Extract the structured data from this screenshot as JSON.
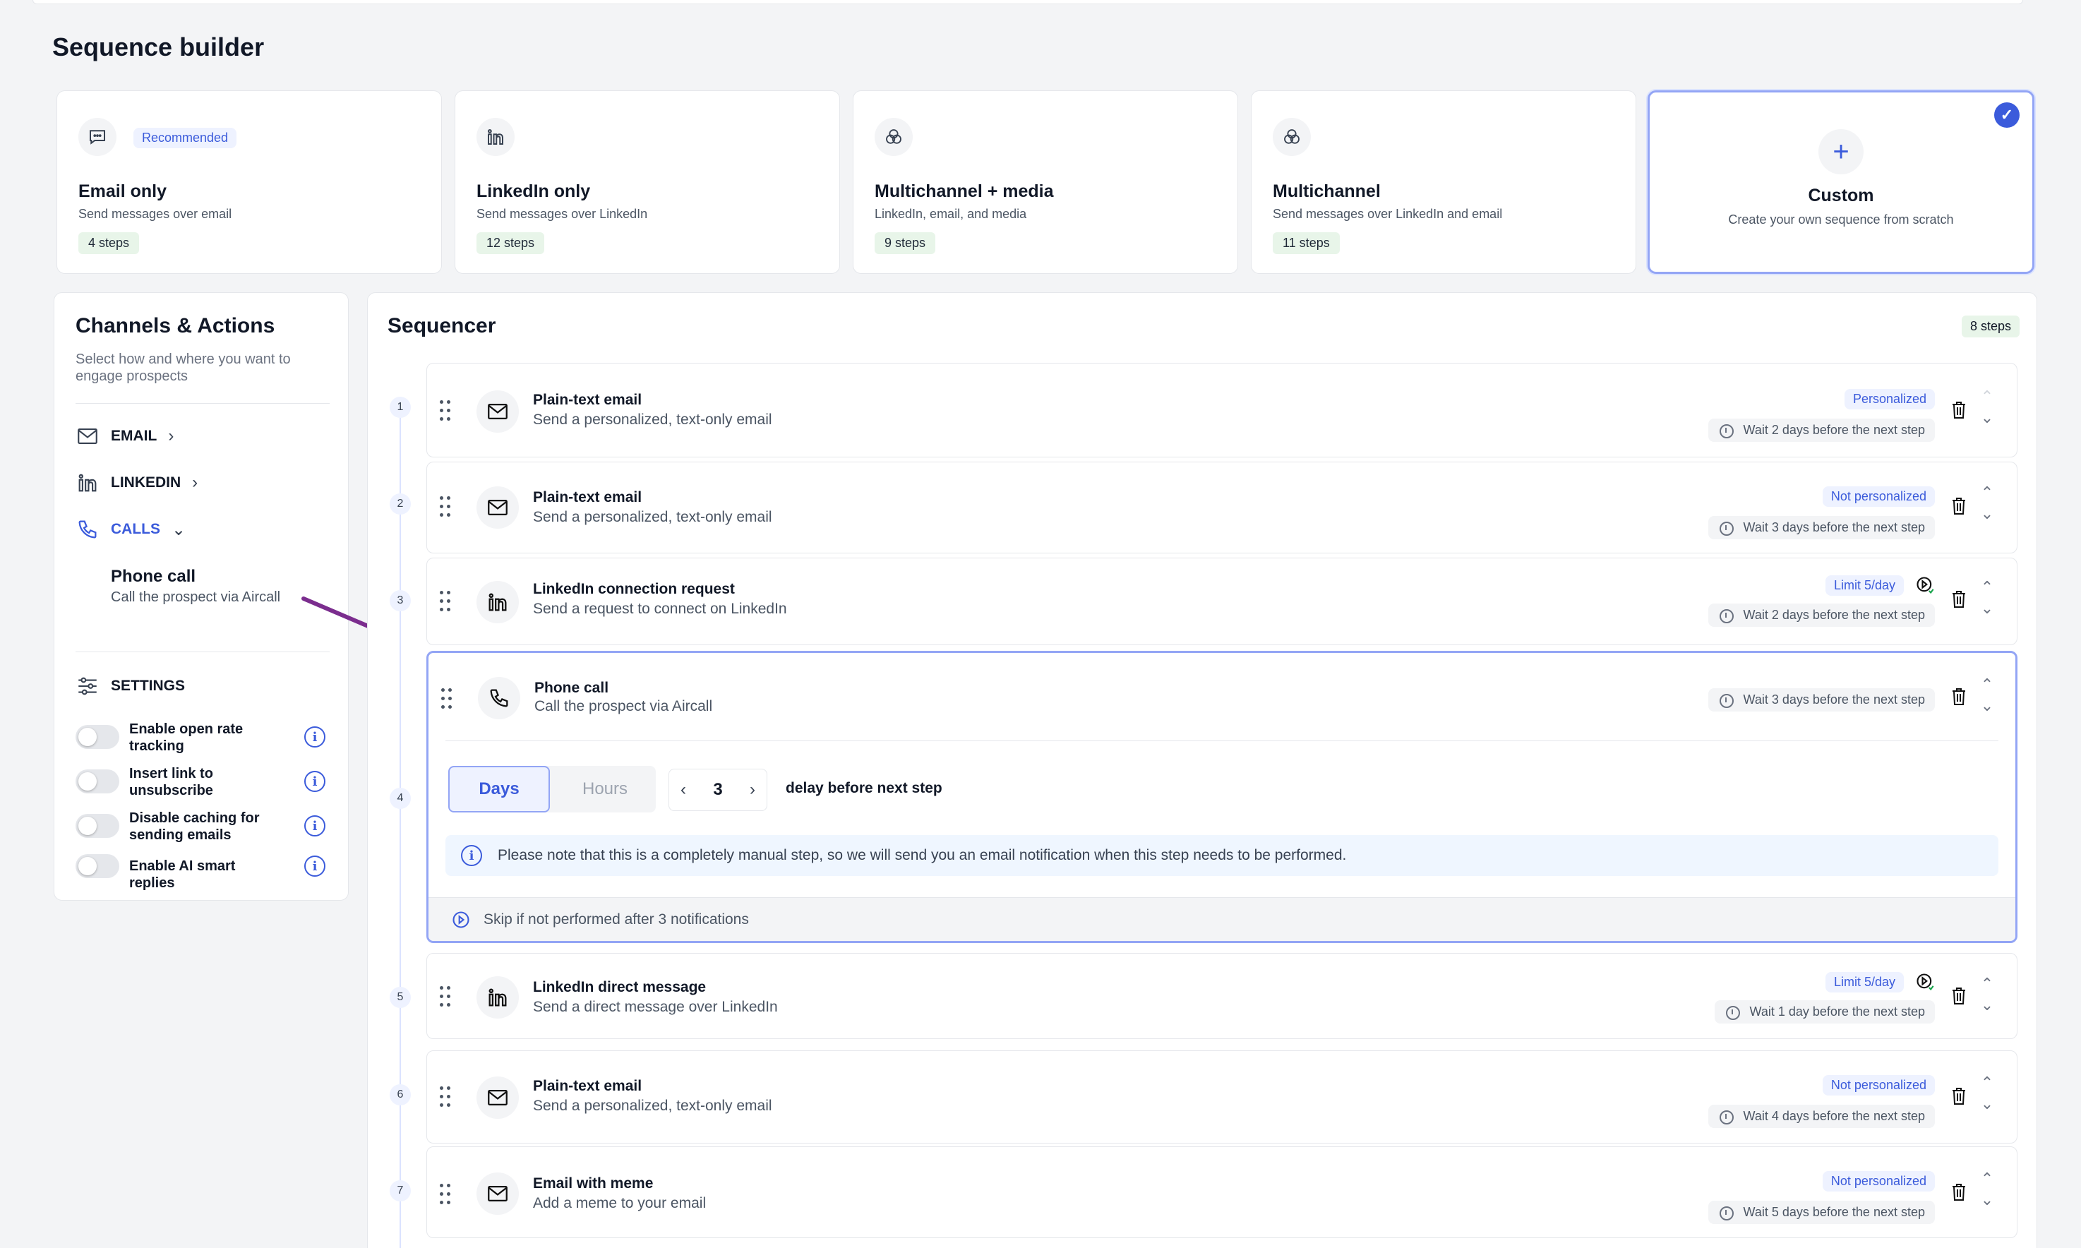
{
  "page": {
    "title": "Sequence builder"
  },
  "templates": [
    {
      "name": "Email only",
      "desc": "Send messages over email",
      "steps": "4 steps",
      "badge": "Recommended",
      "icon": "chat-icon"
    },
    {
      "name": "LinkedIn only",
      "desc": "Send messages over LinkedIn",
      "steps": "12 steps",
      "icon": "linkedin-icon"
    },
    {
      "name": "Multichannel + media",
      "desc": "LinkedIn, email, and media",
      "steps": "9 steps",
      "icon": "venn-icon"
    },
    {
      "name": "Multichannel",
      "desc": "Send messages over LinkedIn and email",
      "steps": "11 steps",
      "icon": "venn-icon"
    },
    {
      "name": "Custom",
      "desc": "Create your own sequence from scratch",
      "plus": "+",
      "check": "✓",
      "icon": "plus-icon"
    }
  ],
  "channels": {
    "title": "Channels & Actions",
    "subtitle": "Select how and where you want to engage prospects",
    "items": [
      {
        "label": "EMAIL",
        "icon": "mail-icon",
        "chevron": "›"
      },
      {
        "label": "LINKEDIN",
        "icon": "linkedin-icon",
        "chevron": "›"
      },
      {
        "label": "CALLS",
        "icon": "phone-icon",
        "chevron": "⌄"
      }
    ],
    "calls_action": {
      "title": "Phone call",
      "desc": "Call the prospect via Aircall"
    },
    "settings_label": "SETTINGS",
    "settings": [
      {
        "label": "Enable open rate tracking",
        "on": false
      },
      {
        "label": "Insert link to unsubscribe",
        "on": false
      },
      {
        "label": "Disable caching for sending emails",
        "on": false
      },
      {
        "label": "Enable AI smart replies",
        "on": false
      }
    ],
    "info_glyph": "i"
  },
  "sequencer": {
    "title": "Sequencer",
    "total": "8 steps",
    "steps": [
      {
        "num": "1",
        "title": "Plain-text email",
        "desc": "Send a personalized, text-only email",
        "tag": "Personalized",
        "wait": "Wait 2 days before the next step",
        "icon": "mail-icon"
      },
      {
        "num": "2",
        "title": "Plain-text email",
        "desc": "Send a personalized, text-only email",
        "tag": "Not personalized",
        "wait": "Wait 3 days before the next step",
        "icon": "mail-icon"
      },
      {
        "num": "3",
        "title": "LinkedIn connection request",
        "desc": "Send a request to connect on LinkedIn",
        "tag": "Limit 5/day",
        "wait": "Wait 2 days before the next step",
        "icon": "linkedin-icon"
      },
      {
        "num": "4",
        "title": "Phone call",
        "desc": "Call the prospect via Aircall",
        "wait": "Wait 3 days before the next step",
        "icon": "phone-icon",
        "expanded": {
          "unit_days": "Days",
          "unit_hours": "Hours",
          "delay_value": "3",
          "prev": "‹",
          "next": "›",
          "delay_label": "delay before next step",
          "note": "Please note that this is a completely manual step, so we will send you an email notification when this step needs to be performed.",
          "skip": "Skip if not performed after 3 notifications"
        }
      },
      {
        "num": "5",
        "title": "LinkedIn direct message",
        "desc": "Send a direct message over LinkedIn",
        "tag": "Limit 5/day",
        "wait": "Wait 1 day before the next step",
        "icon": "linkedin-icon"
      },
      {
        "num": "6",
        "title": "Plain-text email",
        "desc": "Send a personalized, text-only email",
        "tag": "Not personalized",
        "wait": "Wait 4 days before the next step",
        "icon": "mail-icon"
      },
      {
        "num": "7",
        "title": "Email with meme",
        "desc": "Add a meme to your email",
        "tag": "Not personalized",
        "wait": "Wait 5 days before the next step",
        "icon": "mail-icon"
      }
    ],
    "arrow_up": "⌃",
    "arrow_down": "⌄"
  },
  "colors": {
    "accent": "#3b5bdb",
    "annotation_arrow": "#7b2d8e",
    "tag_bg": "#eef2ff",
    "steps_bg": "#e8f5e9"
  }
}
